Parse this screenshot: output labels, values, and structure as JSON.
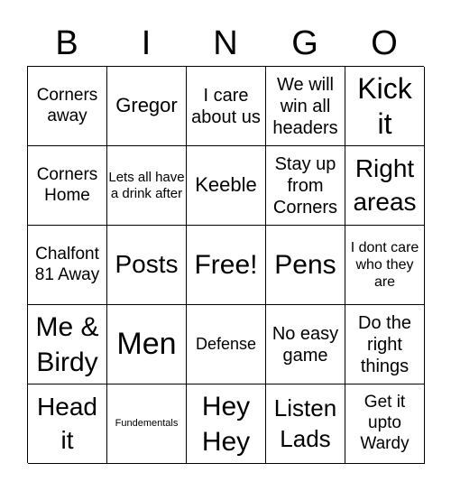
{
  "header": [
    "B",
    "I",
    "N",
    "G",
    "O"
  ],
  "cells": [
    "Corners away",
    "Gregor",
    "I care about us",
    "We will win all headers",
    "Kick it",
    "Corners Home",
    "Lets all have a drink after",
    "Keeble",
    "Stay up from Corners",
    "Right areas",
    "Chalfont 81 Away",
    "Posts",
    "Free!",
    "Pens",
    "I dont care who they are",
    "Me & Birdy",
    "Men",
    "Defense",
    "No easy game",
    "Do the right things",
    "Head it",
    "Fundementals",
    "Hey Hey",
    "Listen Lads",
    "Get it upto Wardy"
  ]
}
